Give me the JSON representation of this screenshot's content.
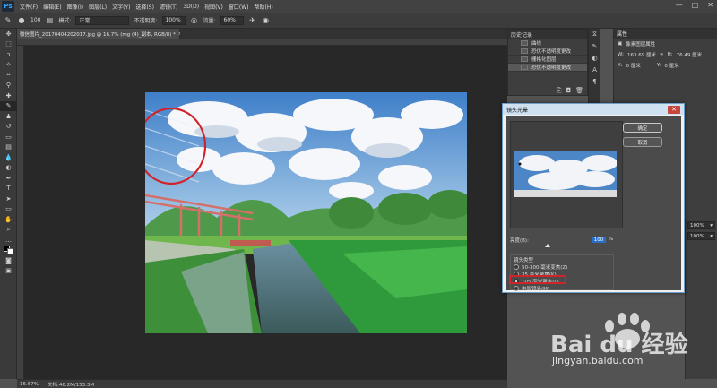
{
  "app": {
    "logo": "Ps"
  },
  "menu": [
    "文件(F)",
    "编辑(E)",
    "图像(I)",
    "图层(L)",
    "文字(Y)",
    "选择(S)",
    "滤镜(T)",
    "3D(D)",
    "视图(V)",
    "窗口(W)",
    "帮助(H)"
  ],
  "window_controls": [
    "—",
    "□",
    "✕"
  ],
  "options": {
    "size": "100",
    "mode_label": "模式:",
    "mode_value": "正常",
    "opacity_label": "不透明度:",
    "opacity_value": "100%",
    "flow_label": "流量:",
    "flow_value": "60%"
  },
  "document": {
    "tab_title": "微信图片_20170404202017.jpg @ 16.7% (mg (4)_副本, RGB/8) *",
    "tab_close": "×"
  },
  "status": {
    "zoom": "16.67%",
    "doc_info": "文档:46.2M/153.3M"
  },
  "history": {
    "title": "历史记录",
    "items": [
      "曲线",
      "恐伏不透明度更改",
      "栅格化图层",
      "恐伏不透明度更改"
    ]
  },
  "properties": {
    "title": "属性",
    "subtitle": "像素图层属性",
    "w_label": "W:",
    "w_value": "163.69 厘米",
    "link": "∞",
    "h_label": "H:",
    "h_value": "76.49 厘米",
    "x_label": "X:",
    "x_value": "0 厘米",
    "y_label": "Y:",
    "y_value": "0 厘米"
  },
  "layers": {
    "opacity": "100%",
    "fill": "100%"
  },
  "dialog": {
    "title": "镜头光晕",
    "close": "✕",
    "ok": "确定",
    "cancel": "取消",
    "brightness_label": "亮度(B):",
    "brightness_value": "100",
    "brightness_unit": "%",
    "brightness_level": 0.33,
    "lens_type_label": "镜头类型",
    "lens_types": [
      "50-300 毫米变焦(Z)",
      "35 毫米聚焦(K)",
      "105 毫米聚焦(L)",
      "电影镜头(M)"
    ],
    "selected_lens": 2
  },
  "watermark": {
    "brand": "Bai du 经验",
    "url": "jingyan.baidu.com"
  },
  "colors": {
    "accent": "#31a8ff",
    "annotation": "#d0232a",
    "dialog_title": "#cfe0f1"
  }
}
